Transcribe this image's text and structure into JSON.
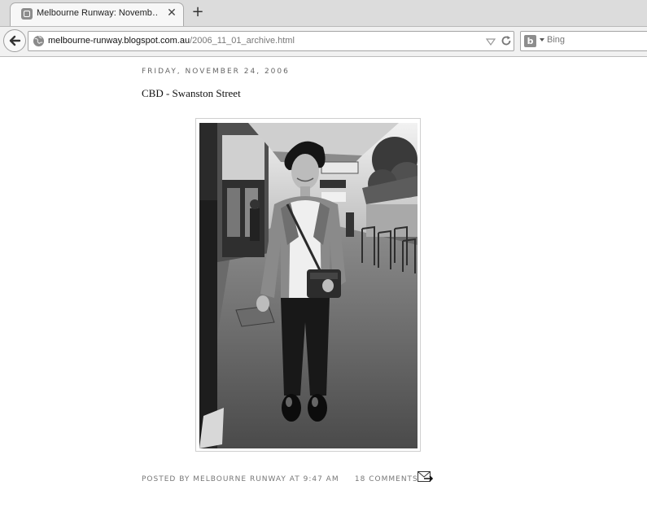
{
  "browser": {
    "tab": {
      "title": "Melbourne Runway: Novemb…",
      "close_glyph": "✕",
      "favicon": "blogger-icon"
    },
    "new_tab_glyph": "+",
    "url": {
      "host": "melbourne-runway.blogspot.com.au",
      "path": "/2006_11_01_archive.html"
    },
    "search": {
      "engine": "bing-icon",
      "engine_letter": "b",
      "placeholder": "Bing"
    }
  },
  "post": {
    "date_header": "FRIDAY, NOVEMBER 24, 2006",
    "title": "CBD - Swanston Street",
    "photo": {
      "description_icon": "street-fashion-photo",
      "tone": "grayscale"
    },
    "footer": {
      "posted_by_label": "POSTED BY",
      "author": "MELBOURNE RUNWAY",
      "at_label": "AT",
      "time": "9:47 AM",
      "comments": "18 COMMENTS"
    }
  },
  "colors": {
    "chrome_bg": "#dcdcdc",
    "nav_bg": "#f1f1f1",
    "meta_text": "#777777",
    "title_text": "#111111"
  }
}
